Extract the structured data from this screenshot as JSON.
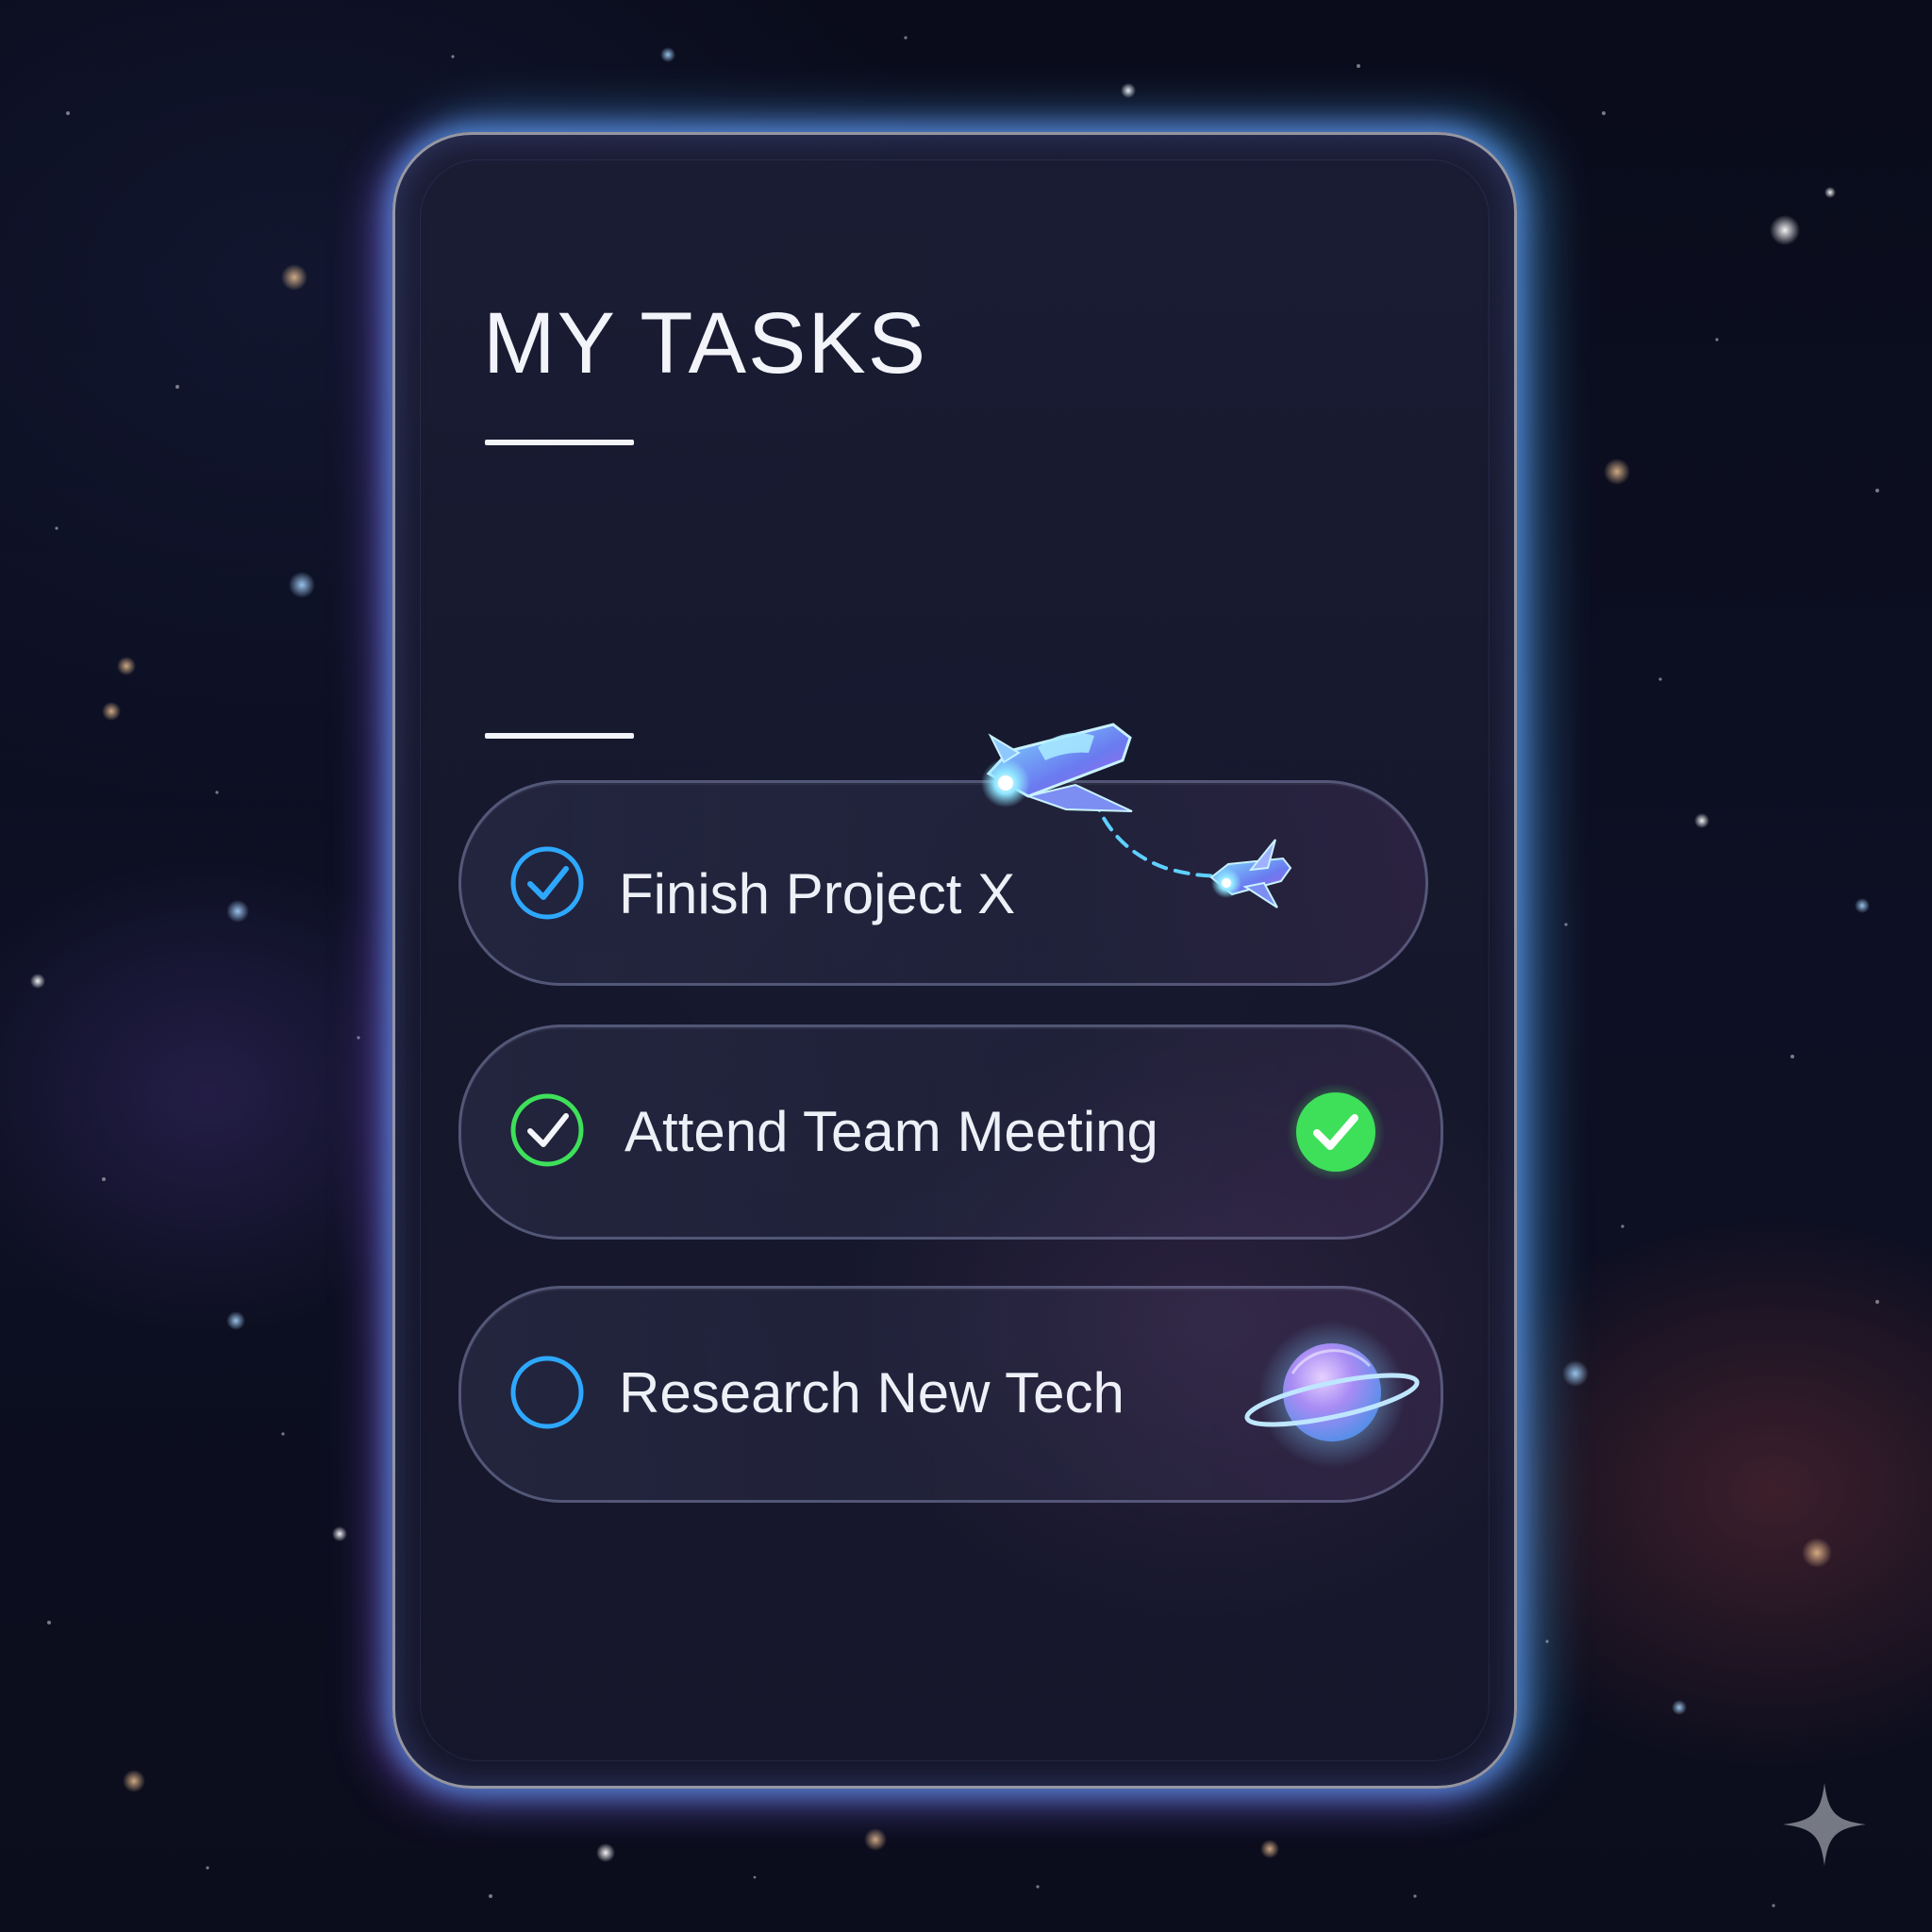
{
  "header": {
    "title": "MY TASKS"
  },
  "tasks": [
    {
      "label": "Finish Project X",
      "status": "checked",
      "check_color": "#2ea8ff",
      "icon": "spaceship-icon"
    },
    {
      "label": "Attend Team Meeting",
      "status": "completed",
      "check_color": "#3ee05a",
      "icon": "completed-badge-icon"
    },
    {
      "label": "Research New Tech",
      "status": "unchecked",
      "check_color": "#2ea8ff",
      "icon": "planet-icon"
    }
  ],
  "colors": {
    "accent_blue": "#2ea8ff",
    "accent_green": "#3ee05a",
    "glow_purple": "#a05aff",
    "glow_cyan": "#50beff",
    "background": "#0b0d1c"
  },
  "icons": [
    "check-circle-icon",
    "spaceship-icon",
    "completed-badge-icon",
    "empty-circle-icon",
    "planet-icon",
    "sparkle-icon"
  ]
}
